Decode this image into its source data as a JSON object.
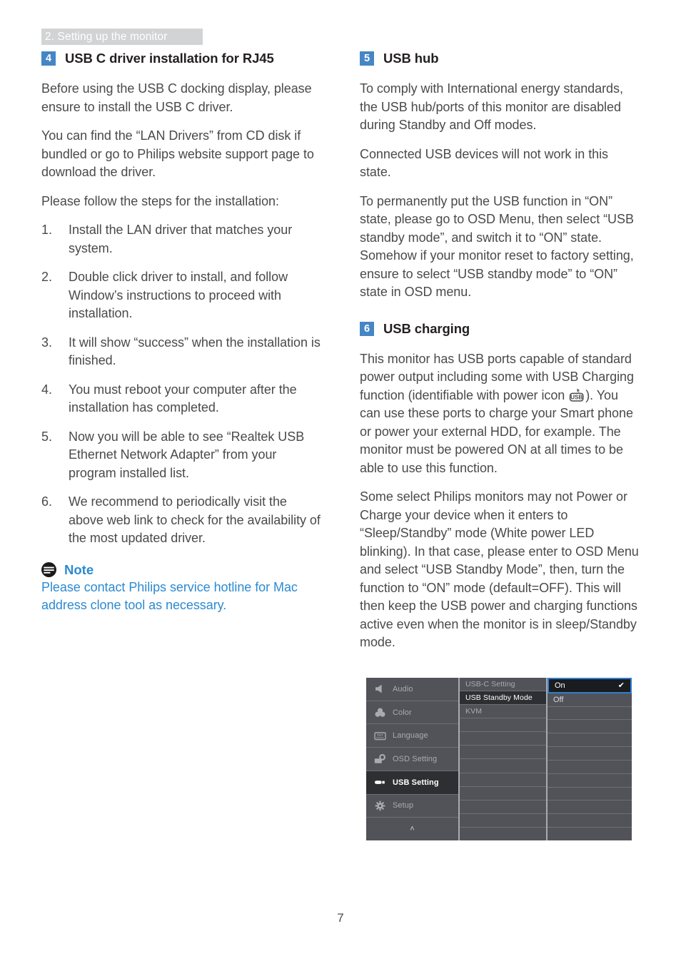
{
  "header": {
    "running_head": "2. Setting up the monitor",
    "bg_color": "#d2d3d4",
    "text_color": "#ffffff"
  },
  "colors": {
    "badge_blue": "#4586c4",
    "note_blue": "#2b8ad1",
    "body_text": "#4a4a4c",
    "osd_bg": "#515359",
    "osd_active": "#2e2f33",
    "osd_highlight_border": "#2f7fd0"
  },
  "left_column": {
    "section": {
      "badge": "4",
      "title": "USB C driver installation for RJ45"
    },
    "paragraphs": [
      "Before using the USB C docking display, please ensure to install the USB C driver.",
      "You can find the “LAN Drivers” from CD disk if bundled or go to Philips website support page to download the driver.",
      "Please follow the steps for the installation:"
    ],
    "steps": [
      {
        "num": "1.",
        "text": "Install the LAN driver that matches your system."
      },
      {
        "num": "2.",
        "text": "Double click driver to install, and follow Window’s instructions to proceed with installation."
      },
      {
        "num": "3.",
        "text": "It will show “success” when the installation is finished."
      },
      {
        "num": "4.",
        "text": "You must reboot your computer after the installation has completed."
      },
      {
        "num": "5.",
        "text": "Now you will be able to see “Realtek USB Ethernet Network Adapter” from your program installed list."
      },
      {
        "num": "6.",
        "text": "We recommend to periodically visit the above web link to check for the availability of the most updated driver."
      }
    ],
    "note": {
      "icon": "note-icon",
      "label": "Note",
      "body": "Please contact Philips service hotline for Mac address clone tool as necessary."
    }
  },
  "right_column": {
    "section_usb_hub": {
      "badge": "5",
      "title": "USB hub",
      "paragraphs": [
        "To comply with International energy standards, the USB hub/ports of this monitor are disabled during Standby and Off modes.",
        "Connected USB devices will not work in this state.",
        "To permanently put the USB function in “ON” state, please go to OSD Menu, then select “USB standby mode”, and switch it to “ON” state. Somehow if your monitor reset to factory setting, ensure to select “USB standby mode” to “ON” state in OSD menu."
      ]
    },
    "section_usb_charging": {
      "badge": "6",
      "title": "USB charging",
      "paragraph_1_part_a": "This monitor has USB ports capable of standard power output including some with USB Charging function (identifiable with power icon ",
      "paragraph_1_part_b": "). You can use these ports to charge your Smart phone or power your external HDD, for example. The monitor must be powered ON at all times to be able to use this function.",
      "inline_icon": "usb-charging-icon",
      "paragraph_2": "Some select Philips monitors may not Power or Charge your device when it enters to “Sleep/Standby” mode (White power LED blinking). In that case, please enter to OSD Menu and select “USB Standby Mode”, then, turn the function to “ON” mode (default=OFF). This will then keep the USB power and charging functions active even when the monitor is in sleep/Standby mode."
    }
  },
  "osd_menu": {
    "left_items": [
      {
        "label": "Audio",
        "icon": "speaker-icon",
        "active": false
      },
      {
        "label": "Color",
        "icon": "color-icon",
        "active": false
      },
      {
        "label": "Language",
        "icon": "text-icon",
        "active": false
      },
      {
        "label": "OSD Setting",
        "icon": "osd-setting-icon",
        "active": false
      },
      {
        "label": "USB Setting",
        "icon": "usb-plug-icon",
        "active": true
      },
      {
        "label": "Setup",
        "icon": "gear-icon",
        "active": false
      },
      {
        "label": "",
        "icon": "chevron-up-icon",
        "active": false
      }
    ],
    "mid_items": [
      {
        "label": "USB-C Setting",
        "selected": false
      },
      {
        "label": "USB Standby Mode",
        "selected": true
      },
      {
        "label": "KVM",
        "selected": false
      },
      {
        "label": "",
        "selected": false
      },
      {
        "label": "",
        "selected": false
      },
      {
        "label": "",
        "selected": false
      },
      {
        "label": "",
        "selected": false
      },
      {
        "label": "",
        "selected": false
      },
      {
        "label": "",
        "selected": false
      },
      {
        "label": "",
        "selected": false
      },
      {
        "label": "",
        "selected": false
      },
      {
        "label": "",
        "selected": false
      }
    ],
    "right_options": [
      {
        "label": "On",
        "checked": true,
        "highlight": true
      },
      {
        "label": "Off",
        "checked": false,
        "highlight": false
      },
      {
        "label": "",
        "checked": false,
        "highlight": false
      },
      {
        "label": "",
        "checked": false,
        "highlight": false
      },
      {
        "label": "",
        "checked": false,
        "highlight": false
      },
      {
        "label": "",
        "checked": false,
        "highlight": false
      },
      {
        "label": "",
        "checked": false,
        "highlight": false
      },
      {
        "label": "",
        "checked": false,
        "highlight": false
      },
      {
        "label": "",
        "checked": false,
        "highlight": false
      },
      {
        "label": "",
        "checked": false,
        "highlight": false
      },
      {
        "label": "",
        "checked": false,
        "highlight": false
      },
      {
        "label": "",
        "checked": false,
        "highlight": false
      }
    ],
    "check_glyph": "✔",
    "chevron_glyph": "˄"
  },
  "footer": {
    "page_number": "7"
  }
}
